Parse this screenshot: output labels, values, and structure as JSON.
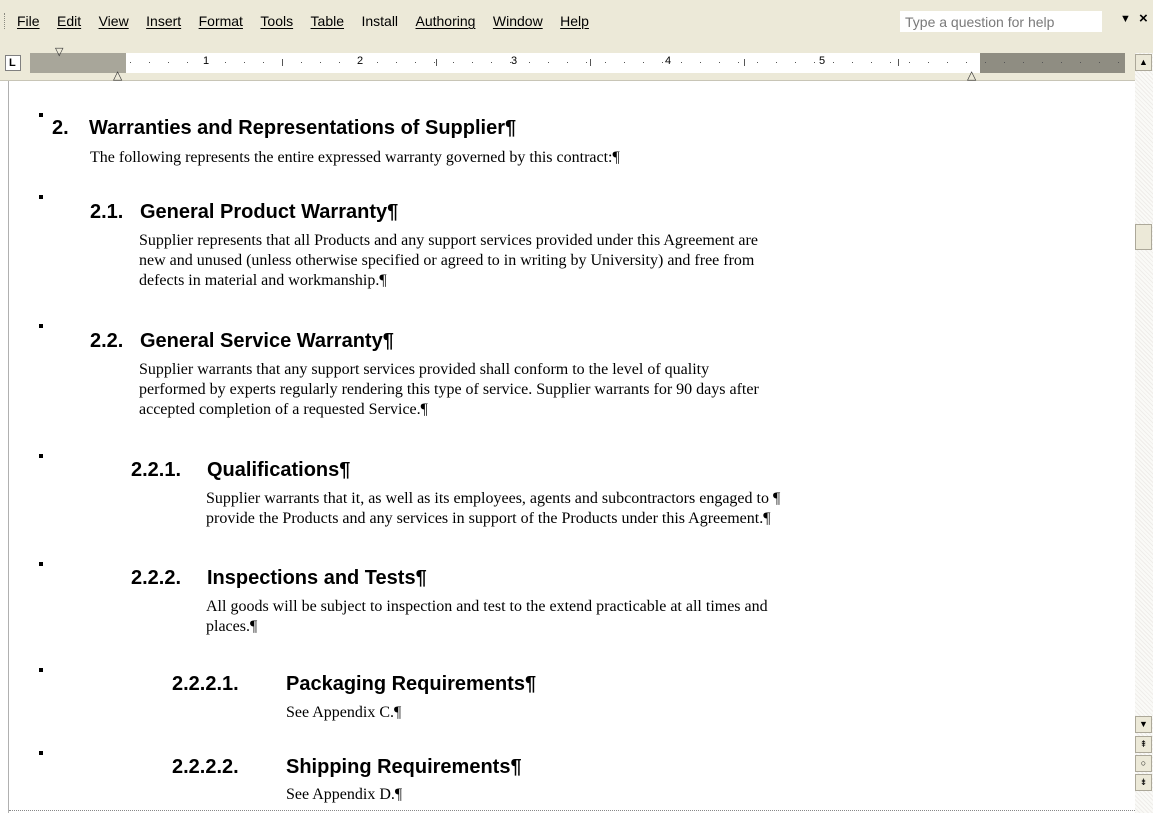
{
  "menu": {
    "items": [
      "File",
      "Edit",
      "View",
      "Insert",
      "Format",
      "Tools",
      "Table",
      "Install",
      "Authoring",
      "Window",
      "Help"
    ],
    "help_placeholder": "Type a question for help",
    "help_dropdown_icon": "chevron-down-icon",
    "close_glyph": "×"
  },
  "ruler": {
    "tab_selector": "L",
    "numbers": [
      "1",
      "2",
      "3",
      "4",
      "5"
    ]
  },
  "scrollbar": {
    "up_icon": "▲",
    "down_icon": "▼",
    "prev_page_icon": "⇞",
    "browse_icon": "○",
    "next_page_icon": "⇟"
  },
  "document": {
    "h1": {
      "number": "2.",
      "title": "Warranties and Representations of Supplier¶",
      "body": [
        "The following represents the entire expressed warranty governed by this contract:¶"
      ]
    },
    "h2_1": {
      "number": "2.1.",
      "title": "General Product Warranty¶",
      "body": [
        "Supplier represents that all Products and any support services provided under this Agreement are",
        "new and unused (unless otherwise specified or agreed to in writing by University) and free from",
        "defects in material and workmanship.¶"
      ]
    },
    "h2_2": {
      "number": "2.2.",
      "title": "General Service Warranty¶",
      "body": [
        "Supplier warrants that any support services provided shall conform to the level of quality",
        "performed by experts regularly rendering this type of service.  Supplier warrants for 90 days after",
        "accepted completion of a requested Service.¶"
      ]
    },
    "h3_1": {
      "number": "2.2.1.",
      "title": "Qualifications¶",
      "body": [
        "Supplier warrants that it, as well as its employees, agents and subcontractors engaged to ¶",
        "provide the Products and any services in support of the Products under this Agreement.¶"
      ]
    },
    "h3_2": {
      "number": "2.2.2.",
      "title": "Inspections and Tests¶",
      "body": [
        "All goods will be subject to inspection and test to the extend practicable at all times and",
        "places.¶"
      ]
    },
    "h4_1": {
      "number": "2.2.2.1.",
      "title": "Packaging Requirements¶",
      "body": [
        "See Appendix C.¶"
      ]
    },
    "h4_2": {
      "number": "2.2.2.2.",
      "title": "Shipping Requirements¶",
      "body": [
        "See Appendix D.¶"
      ]
    }
  }
}
